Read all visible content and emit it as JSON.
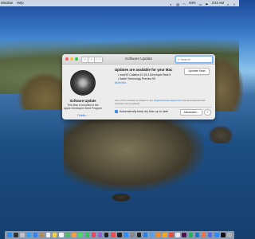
{
  "menubar": {
    "items": [
      "Window",
      "Help"
    ],
    "battery": "84%",
    "time": "3:42 AM"
  },
  "window": {
    "title": "Software Update",
    "search_placeholder": "Search"
  },
  "sidebar": {
    "title": "Software Update",
    "description": "This Mac is enrolled in the Apple Developer Seed Program",
    "details_link": "Details..."
  },
  "main": {
    "heading": "Updates are available for your Mac",
    "items": [
      "macOS Catalina 10.15.4 Developer Beta 5",
      "Safari Technology Preview 99"
    ],
    "more_info": "More info...",
    "update_button": "Update Now",
    "notice_text": "Use of this software is subject to the",
    "notice_link": "original license agreement",
    "notice_suffix": "that accompanied the software being updated.",
    "auto_label": "Automatically keep my Mac up to date",
    "advanced_button": "Advanced...",
    "help_button": "?"
  },
  "dock": {
    "apps": [
      "finder",
      "siri",
      "launchpad",
      "safari",
      "mail",
      "contacts",
      "calendar",
      "notes",
      "reminders",
      "maps",
      "photos",
      "messages",
      "facetime",
      "music",
      "podcasts",
      "tv",
      "news",
      "stocks",
      "app-store",
      "system-preferences",
      "terminal",
      "xcode",
      "preview",
      "books",
      "home",
      "voice-memos",
      "chrome",
      "slack",
      "spotify",
      "vscode",
      "firefox",
      "discord",
      "zoom",
      "notion",
      "trash"
    ],
    "colors": [
      "#2d8cf0",
      "#333333",
      "#c0c0c8",
      "#3aa0f2",
      "#3b7ff0",
      "#b08a5a",
      "#f2f2f2",
      "#f5d24a",
      "#f4f4f4",
      "#55b66a",
      "#f0a040",
      "#4cd964",
      "#37c25a",
      "#f0425a",
      "#9b59d0",
      "#222222",
      "#f04a4a",
      "#222222",
      "#2f8bf5",
      "#8a8a8a",
      "#222222",
      "#2a7de1",
      "#5aa0e0",
      "#f08a2a",
      "#f5a623",
      "#e74c3c",
      "#e9e9e9",
      "#4a154b",
      "#1db954",
      "#1e78c8",
      "#ff7139",
      "#5865f2",
      "#2d8cff",
      "#111111",
      "#b0b0b0"
    ]
  }
}
